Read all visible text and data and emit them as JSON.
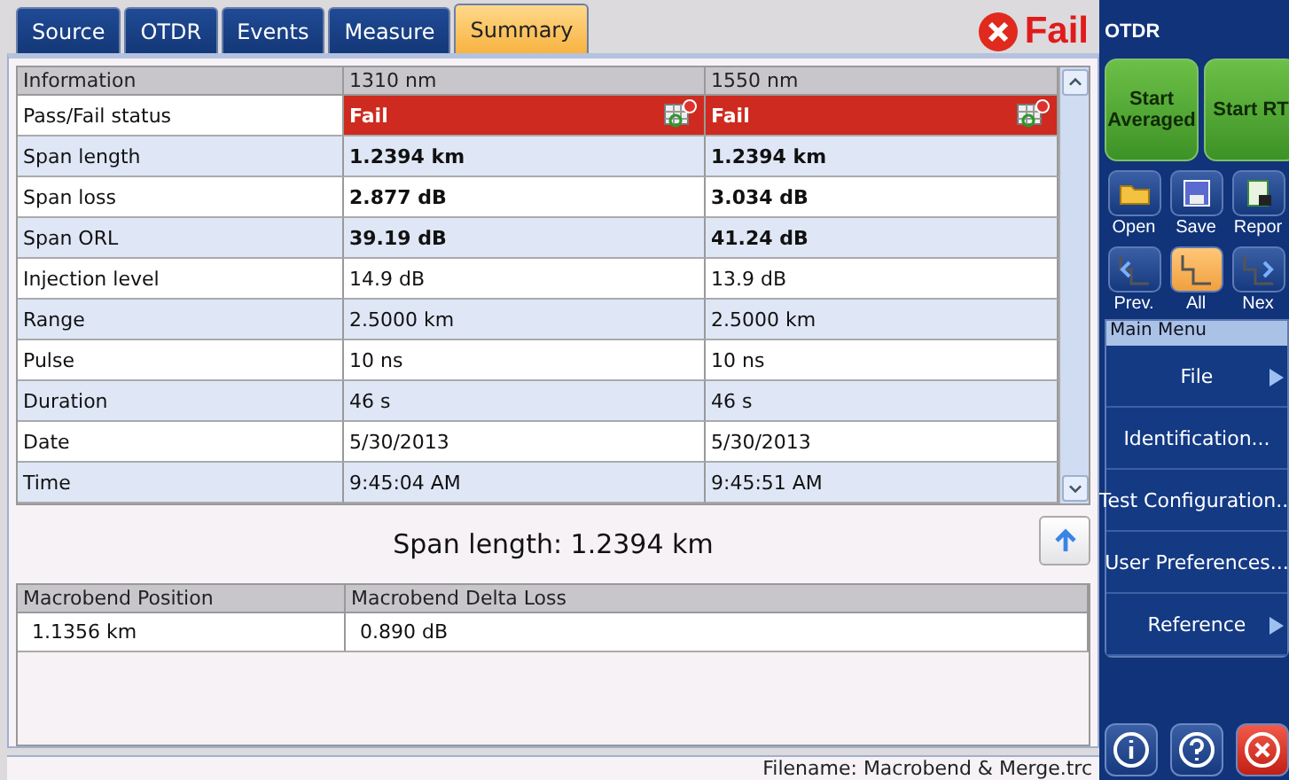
{
  "tabs": [
    {
      "label": "Source",
      "selected": false
    },
    {
      "label": "OTDR",
      "selected": false
    },
    {
      "label": "Events",
      "selected": false
    },
    {
      "label": "Measure",
      "selected": false
    },
    {
      "label": "Summary",
      "selected": true
    }
  ],
  "verdict": {
    "label": "Fail",
    "kind": "fail"
  },
  "summary_table": {
    "columns": [
      "Information",
      "1310 nm",
      "1550 nm"
    ],
    "rows": [
      {
        "kind": "status",
        "cells": [
          "Pass/Fail status",
          "Fail",
          "Fail"
        ]
      },
      {
        "kind": "key",
        "cells": [
          "Span length",
          "1.2394 km",
          "1.2394 km"
        ]
      },
      {
        "kind": "key",
        "cells": [
          "Span loss",
          "2.877 dB",
          "3.034 dB"
        ]
      },
      {
        "kind": "key",
        "cells": [
          "Span ORL",
          "39.19 dB",
          "41.24 dB"
        ]
      },
      {
        "kind": "plain",
        "cells": [
          "Injection level",
          "14.9 dB",
          "13.9 dB"
        ]
      },
      {
        "kind": "plain",
        "cells": [
          "Range",
          "2.5000 km",
          "2.5000 km"
        ]
      },
      {
        "kind": "plain",
        "cells": [
          "Pulse",
          "10 ns",
          "10 ns"
        ]
      },
      {
        "kind": "plain",
        "cells": [
          "Duration",
          "46 s",
          "46 s"
        ]
      },
      {
        "kind": "plain",
        "cells": [
          "Date",
          "5/30/2013",
          "5/30/2013"
        ]
      },
      {
        "kind": "plain",
        "cells": [
          "Time",
          "9:45:04 AM",
          "9:45:51 AM"
        ]
      }
    ]
  },
  "span_heading": "Span length: 1.2394 km",
  "macrobend_table": {
    "columns": [
      "Macrobend Position",
      "Macrobend Delta Loss"
    ],
    "rows": [
      [
        "1.1356 km",
        "0.890 dB"
      ]
    ]
  },
  "filename": "Filename: Macrobend & Merge.trc",
  "panel": {
    "title": "OTDR",
    "start_buttons": [
      "Start Averaged",
      "Start RT"
    ],
    "file_buttons": [
      {
        "label": "Open",
        "kind": "folder"
      },
      {
        "label": "Save",
        "kind": "disk"
      },
      {
        "label": "Repor",
        "kind": "report"
      }
    ],
    "trace_buttons": [
      {
        "label": "Prev.",
        "kind": "prev",
        "selected": false
      },
      {
        "label": "All",
        "kind": "all",
        "selected": true
      },
      {
        "label": "Nex",
        "kind": "next",
        "selected": false
      }
    ],
    "menu_title": "Main Menu",
    "menu": [
      {
        "label": "File",
        "submenu": true
      },
      {
        "label": "Identification...",
        "submenu": false
      },
      {
        "label": "Test Configuration...",
        "submenu": false
      },
      {
        "label": "User Preferences...",
        "submenu": false
      },
      {
        "label": "Reference",
        "submenu": true
      }
    ],
    "bottom_buttons": [
      {
        "kind": "info"
      },
      {
        "kind": "help"
      },
      {
        "kind": "close"
      }
    ]
  }
}
